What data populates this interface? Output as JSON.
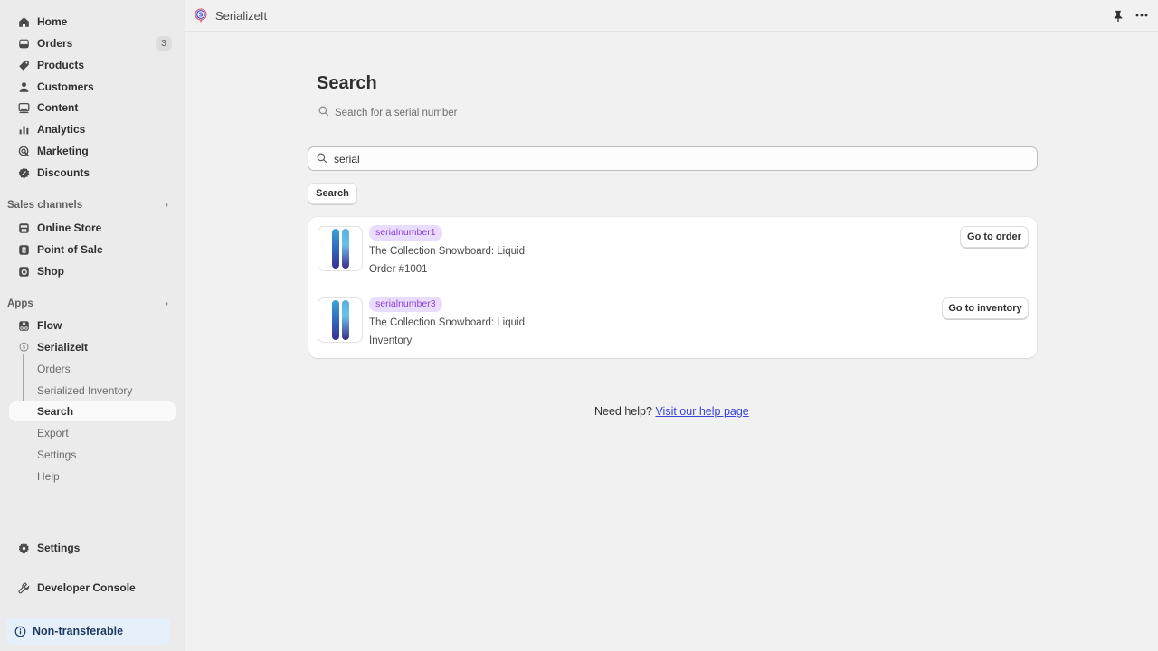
{
  "sidebar": {
    "main_items": [
      {
        "label": "Home",
        "icon": "home-icon"
      },
      {
        "label": "Orders",
        "icon": "orders-inbox-icon",
        "badge": "3"
      },
      {
        "label": "Products",
        "icon": "tag-icon"
      },
      {
        "label": "Customers",
        "icon": "person-icon"
      },
      {
        "label": "Content",
        "icon": "image-icon"
      },
      {
        "label": "Analytics",
        "icon": "bar-chart-icon"
      },
      {
        "label": "Marketing",
        "icon": "target-icon"
      },
      {
        "label": "Discounts",
        "icon": "discount-badge-icon"
      }
    ],
    "sales_channels": {
      "heading": "Sales channels",
      "items": [
        {
          "label": "Online Store",
          "icon": "store-icon"
        },
        {
          "label": "Point of Sale",
          "icon": "pos-icon"
        },
        {
          "label": "Shop",
          "icon": "shop-icon"
        }
      ]
    },
    "apps": {
      "heading": "Apps",
      "items": [
        {
          "label": "Flow",
          "icon": "flow-icon"
        },
        {
          "label": "SerializeIt",
          "icon": "serializeit-pin-icon"
        }
      ],
      "sub_items": [
        {
          "label": "Orders"
        },
        {
          "label": "Serialized Inventory"
        },
        {
          "label": "Search",
          "active": true
        },
        {
          "label": "Export"
        },
        {
          "label": "Settings"
        },
        {
          "label": "Help"
        }
      ]
    },
    "settings_label": "Settings",
    "dev_console_label": "Developer Console",
    "notice_label": "Non-transferable"
  },
  "topbar": {
    "app_title": "SerializeIt",
    "pin_icon": "pin-icon",
    "more_icon": "more-horizontal-icon"
  },
  "main": {
    "title": "Search",
    "subtitle_search_label": "Search for a serial number",
    "search_value": "serial",
    "search_button": "Search",
    "results": [
      {
        "serial": "serialnumber1",
        "product": "The Collection Snowboard: Liquid",
        "reference": "Order #1001",
        "action": "Go to order"
      },
      {
        "serial": "serialnumber3",
        "product": "The Collection Snowboard: Liquid",
        "reference": "Inventory",
        "action": "Go to inventory"
      }
    ],
    "help_prefix": "Need help?",
    "help_link": "Visit our help page"
  },
  "colors": {
    "serial_tag_bg": "#eadcfc",
    "serial_tag_text": "#8b3fd6",
    "link": "#3b43d8",
    "notice_bg": "#e6f0fb"
  }
}
